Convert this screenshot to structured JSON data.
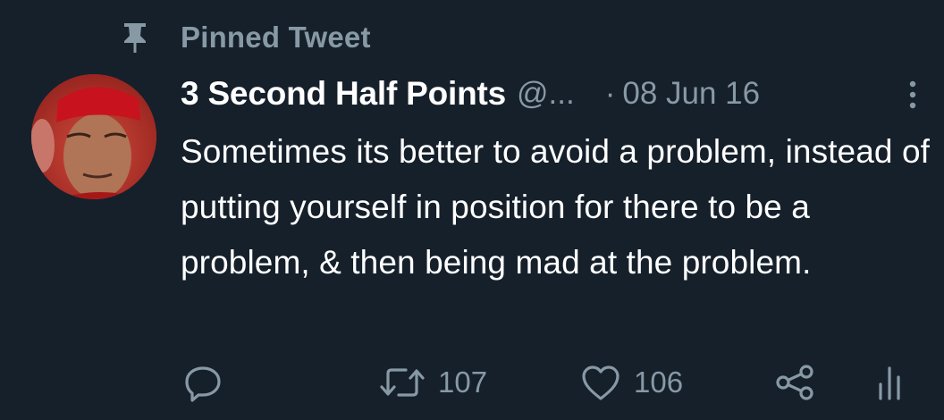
{
  "pinned": {
    "label": "Pinned Tweet",
    "icon": "pin-icon"
  },
  "author": {
    "display_name": "3 Second Half Points",
    "handle": "@...",
    "avatar": "avatar"
  },
  "meta": {
    "separator": "·",
    "date": "08 Jun 16"
  },
  "tweet": {
    "text": "Sometimes its better to avoid a problem, instead of putting yourself in position for there to be a problem, & then being mad at the problem."
  },
  "actions": {
    "reply": {
      "icon": "reply-icon",
      "count": ""
    },
    "retweet": {
      "icon": "retweet-icon",
      "count": "107"
    },
    "like": {
      "icon": "heart-icon",
      "count": "106"
    },
    "share": {
      "icon": "share-icon"
    },
    "analytics": {
      "icon": "analytics-icon"
    }
  },
  "colors": {
    "background": "#15202b",
    "muted": "#8899a6",
    "text": "#ffffff"
  }
}
